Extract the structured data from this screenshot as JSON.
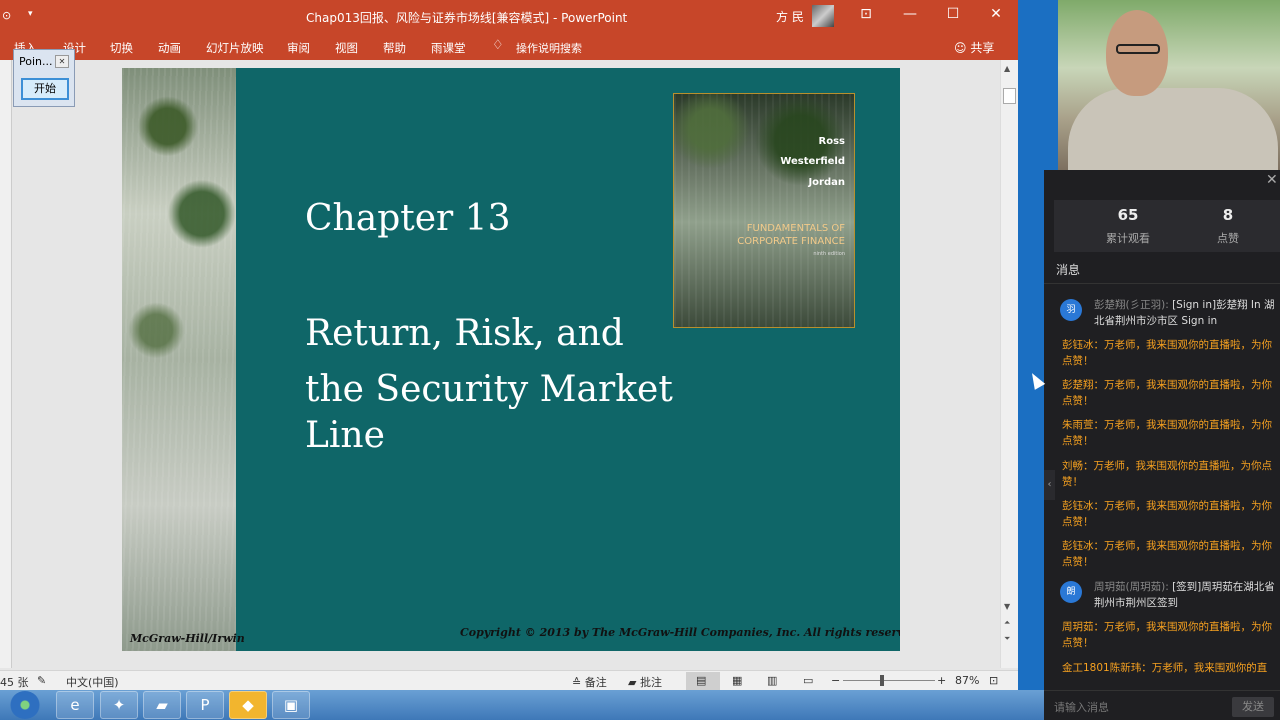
{
  "ppt": {
    "title": "Chap013回报、风险与证券市场线[兼容模式] - PowerPoint",
    "user": "方 民",
    "tabs": [
      "插入",
      "设计",
      "切换",
      "动画",
      "幻灯片放映",
      "审阅",
      "视图",
      "帮助",
      "雨课堂",
      "操作说明搜索"
    ],
    "share": "共享",
    "status": {
      "slide_count": "45 张",
      "language": "中文(中国)",
      "notes": "备注",
      "comments": "批注",
      "zoom": "87%"
    }
  },
  "pointer_window": {
    "title": "Poin...",
    "start": "开始"
  },
  "slide": {
    "chapter": "Chapter 13",
    "title_lines": [
      "Return, Risk, and",
      "the Security Market",
      "Line"
    ],
    "publisher": "McGraw-Hill/Irwin",
    "copyright": "Copyright © 2013 by The McGraw-Hill Companies, Inc. All rights reserved.",
    "cover": {
      "authors": [
        "Ross",
        "Westerfield",
        "Jordan"
      ],
      "book_line1": "FUNDAMENTALS OF",
      "book_line2": "CORPORATE FINANCE",
      "edition": "ninth edition"
    }
  },
  "live": {
    "views": "65",
    "views_label": "累计观看",
    "likes": "8",
    "likes_label": "点赞",
    "messages_header": "消息",
    "messages": [
      {
        "type": "sys",
        "avatar": "羽",
        "name": "彭楚翔(彡正羽):",
        "text": " [Sign in]彭楚翔 In 湖北省荆州市沙市区 Sign in"
      },
      {
        "type": "chat",
        "text": "彭钰冰：万老师，我来围观你的直播啦，为你点赞！"
      },
      {
        "type": "chat",
        "text": "彭楚翔：万老师，我来围观你的直播啦，为你点赞！"
      },
      {
        "type": "chat",
        "text": "朱雨萱：万老师，我来围观你的直播啦，为你点赞！"
      },
      {
        "type": "chat",
        "text": "刘畅：万老师，我来围观你的直播啦，为你点赞！"
      },
      {
        "type": "chat",
        "text": "彭钰冰：万老师，我来围观你的直播啦，为你点赞！"
      },
      {
        "type": "chat",
        "text": "彭钰冰：万老师，我来围观你的直播啦，为你点赞！"
      },
      {
        "type": "sys",
        "avatar": "朗",
        "name": "周玥茹(周玥茹):",
        "text": " [签到]周玥茹在湖北省荆州市荆州区签到"
      },
      {
        "type": "chat",
        "text": "周玥茹：万老师，我来围观你的直播啦，为你点赞！"
      },
      {
        "type": "chat",
        "text": "金工1801陈新玮：万老师，我来围观你的直"
      }
    ],
    "input_placeholder": "请输入消息",
    "send": "发送"
  }
}
